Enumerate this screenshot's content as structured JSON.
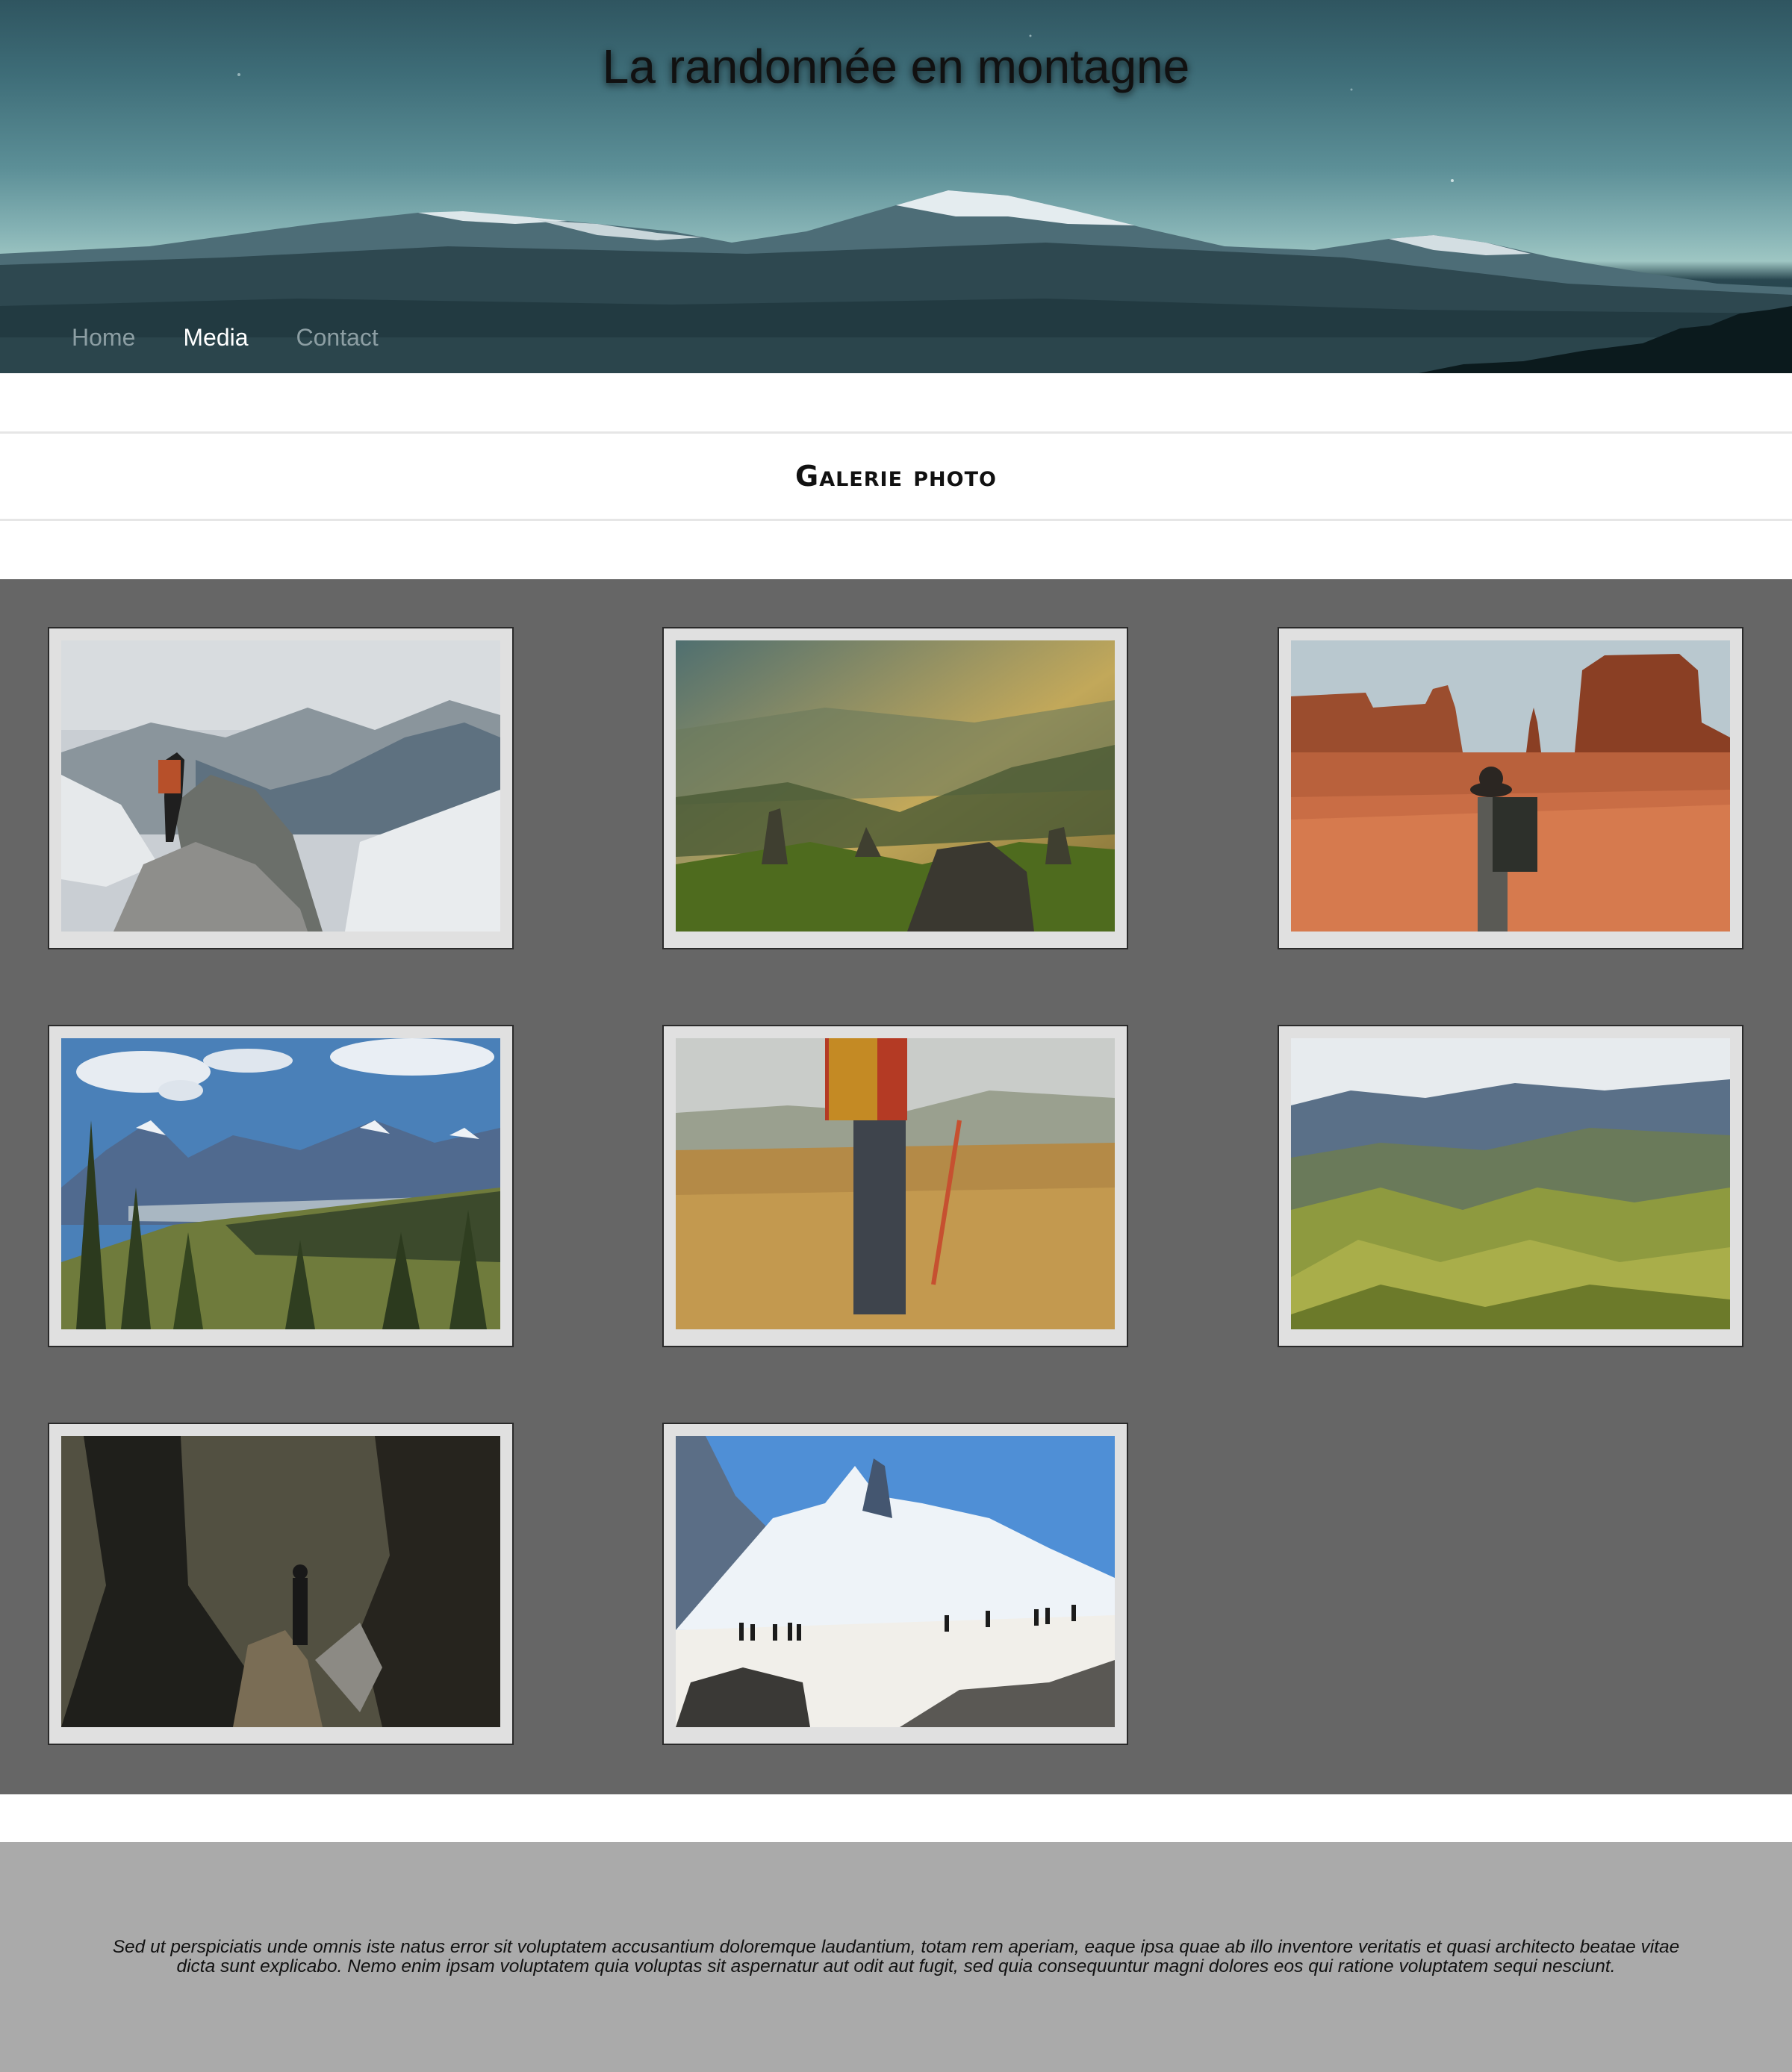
{
  "header": {
    "title": "La randonnée en montagne",
    "nav": [
      {
        "label": "Home",
        "active": false
      },
      {
        "label": "Media",
        "active": true
      },
      {
        "label": "Contact",
        "active": false
      }
    ]
  },
  "section": {
    "title": "Galerie photo"
  },
  "gallery": {
    "photos": [
      {
        "subject": "hiker standing on rocky summit above clouds"
      },
      {
        "subject": "misty golden valley with rock spires"
      },
      {
        "subject": "hiker with hat facing red desert buttes"
      },
      {
        "subject": "pine forest and snowy mountain range under blue sky"
      },
      {
        "subject": "hiker with trekking pole walking through golden grassland"
      },
      {
        "subject": "rolling green hills under cloudy mountains"
      },
      {
        "subject": "hiker on forest trail between large trees"
      },
      {
        "subject": "line of hikers on snowfield below jagged peaks"
      }
    ]
  },
  "footer": {
    "text": "Sed ut perspiciatis unde omnis iste natus error sit voluptatem accusantium doloremque laudantium, totam rem aperiam, eaque ipsa quae ab illo inventore veritatis et quasi architecto beatae vitae dicta sunt explicabo. Nemo enim ipsam voluptatem quia voluptas sit aspernatur aut odit aut fugit, sed quia consequuntur magni dolores eos qui ratione voluptatem sequi nesciunt."
  },
  "colors": {
    "gallery_bg": "#666666",
    "footer_bg": "#aaaaaa",
    "frame_bg": "#e0e0e0",
    "nav_active": "#ffffff",
    "nav_inactive": "#8c9ea3"
  }
}
